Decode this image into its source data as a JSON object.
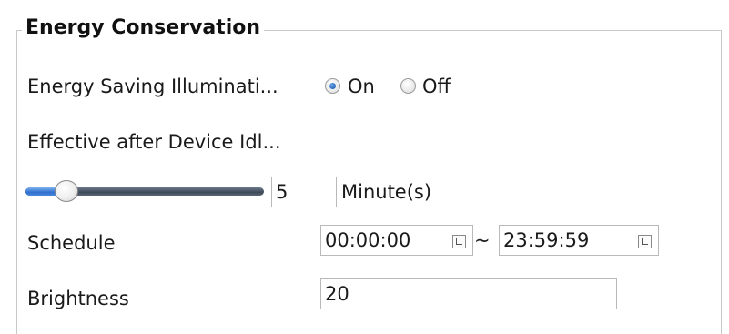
{
  "section": {
    "title": "Energy Conservation"
  },
  "energy_saving": {
    "label": "Energy Saving Illuminati...",
    "options": [
      {
        "label": "On",
        "selected": true
      },
      {
        "label": "Off",
        "selected": false
      }
    ]
  },
  "idle": {
    "label": "Effective after Device Idl...",
    "slider_level_fraction": 0.17,
    "value": "5",
    "unit": "Minute(s)"
  },
  "schedule": {
    "label": "Schedule",
    "start": "00:00:00",
    "separator": "~",
    "end": "23:59:59",
    "picker_icon": "clock-icon"
  },
  "brightness": {
    "label": "Brightness",
    "value": "20"
  },
  "colors": {
    "slider_fill": "#2f6fcf",
    "slider_track": "#3f4a58",
    "radio_selected": "#1f5fb4"
  }
}
